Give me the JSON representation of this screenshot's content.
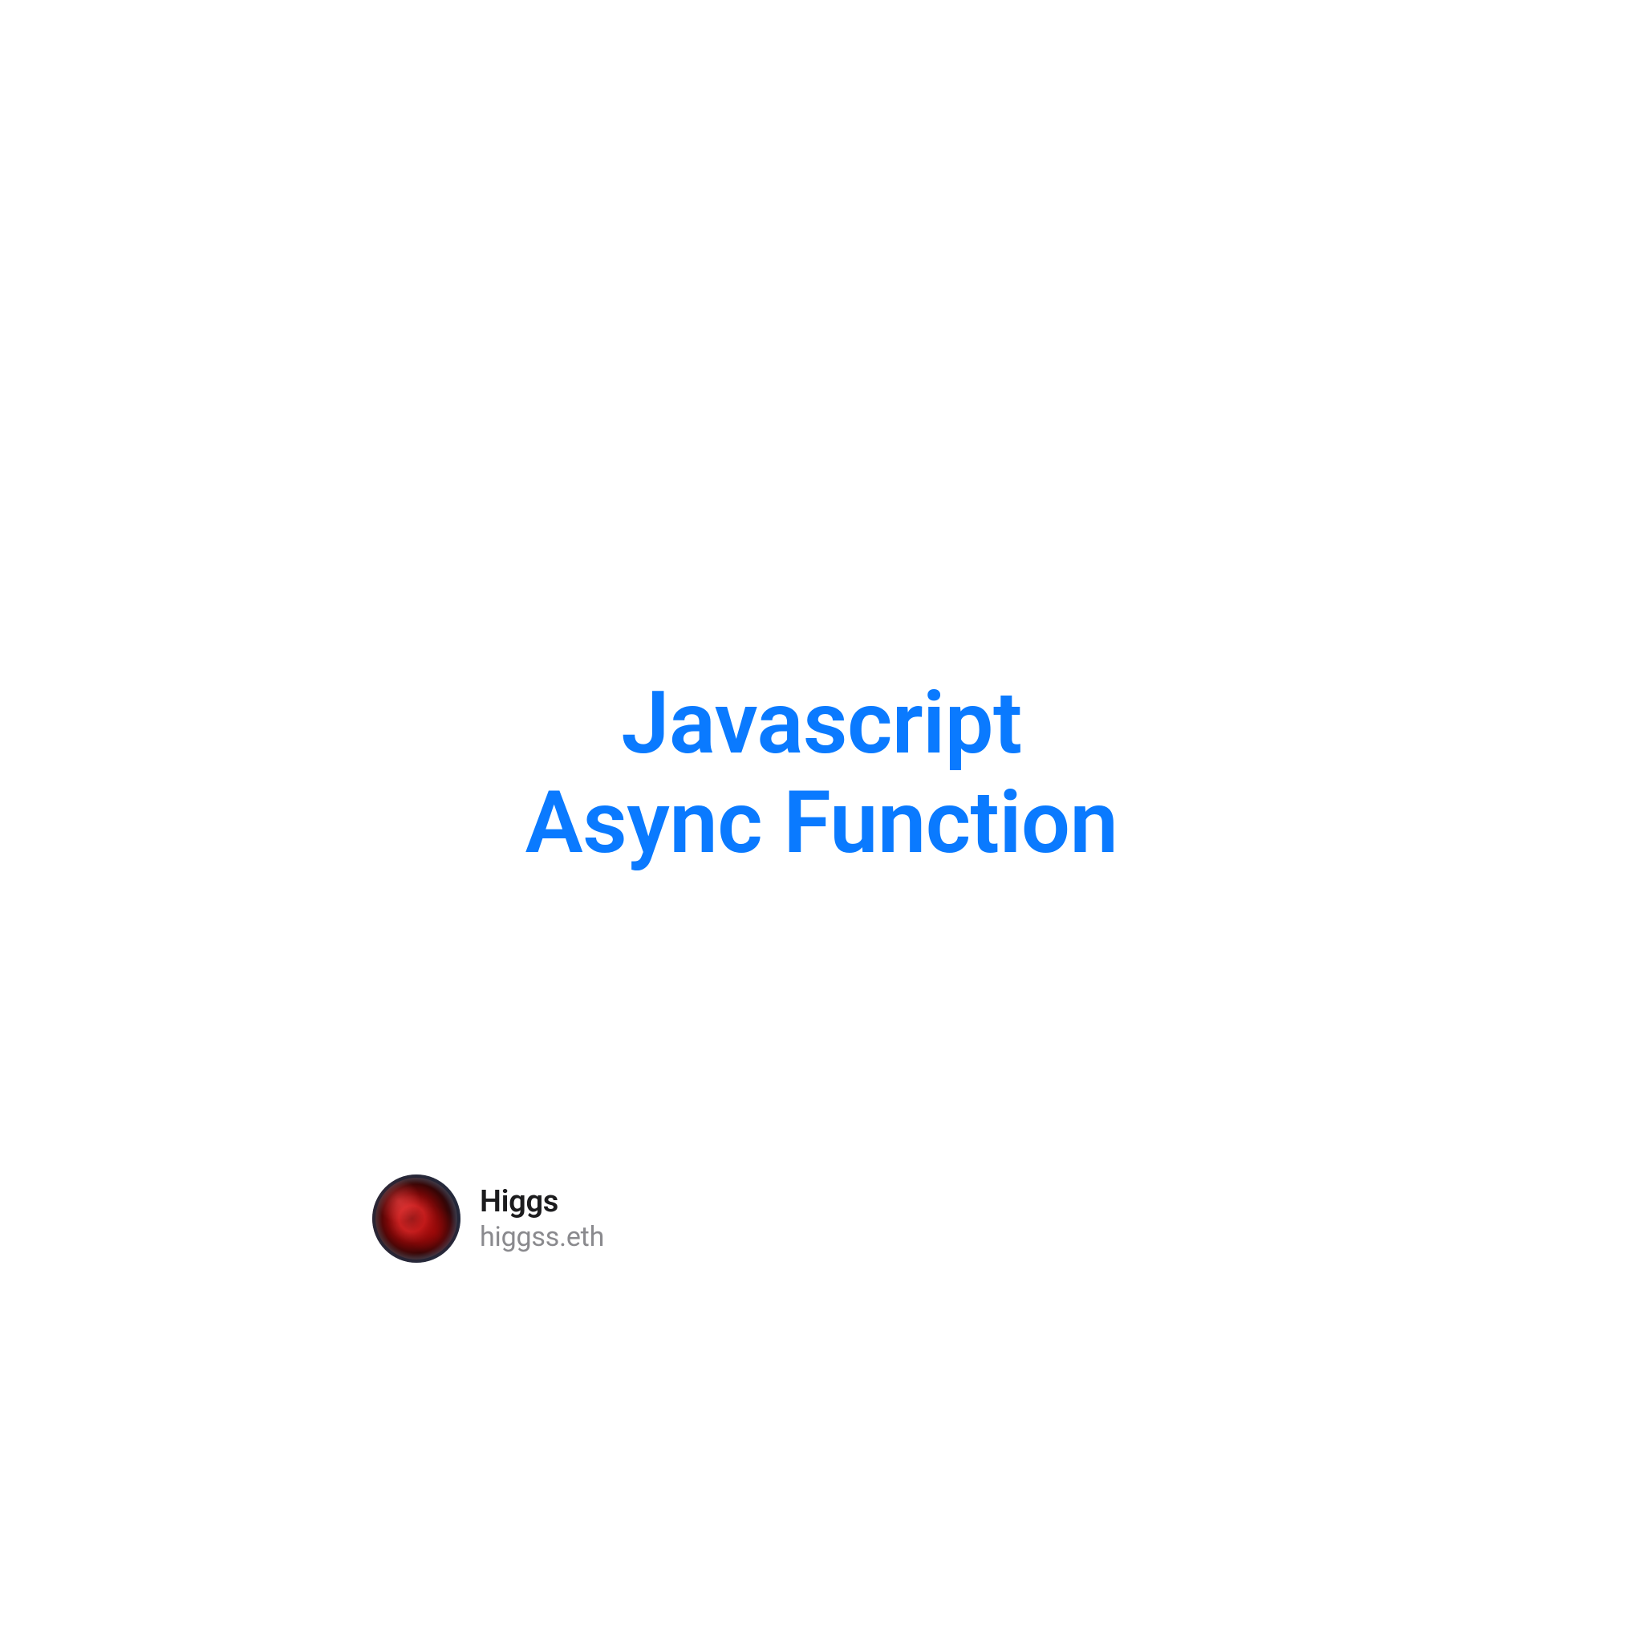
{
  "title": {
    "line1": "Javascript",
    "line2": "Async Function"
  },
  "author": {
    "name": "Higgs",
    "handle": "higgss.eth"
  },
  "colors": {
    "accent": "#0a7aff",
    "text_primary": "#1c1c1e",
    "text_secondary": "#8a8a8e"
  }
}
